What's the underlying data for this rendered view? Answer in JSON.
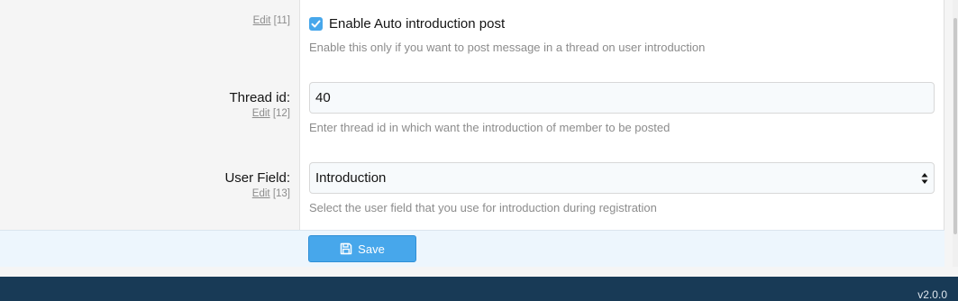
{
  "options": [
    {
      "edit_label": "Edit",
      "edit_num": "[11]",
      "checkbox_label": "Enable Auto introduction post",
      "checked": true,
      "hint": "Enable this only if you want to post message in a thread on user introduction"
    },
    {
      "label": "Thread id:",
      "edit_label": "Edit",
      "edit_num": "[12]",
      "value": "40",
      "hint": "Enter thread id in which want the introduction of member to be posted"
    },
    {
      "label": "User Field:",
      "edit_label": "Edit",
      "edit_num": "[13]",
      "selected": "Introduction",
      "hint": "Select the user field that you use for introduction during registration"
    }
  ],
  "actions": {
    "save_label": "Save"
  },
  "footer": {
    "version": "v2.0.0"
  },
  "colors": {
    "accent": "#47a7eb",
    "footer_bg": "#183a56"
  },
  "icons": {
    "checkbox": "check-icon",
    "save": "floppy-disk-icon",
    "select": "updown-arrow-icon"
  }
}
